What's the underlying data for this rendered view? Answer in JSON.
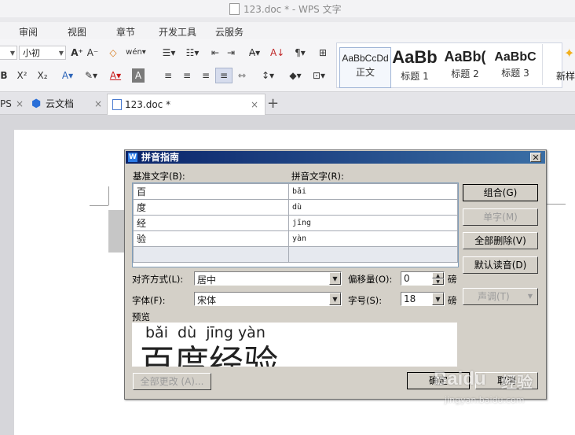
{
  "window": {
    "title": "123.doc * - WPS 文字"
  },
  "menu": {
    "tabs": [
      "审阅",
      "视图",
      "章节",
      "开发工具",
      "云服务"
    ]
  },
  "ribbon": {
    "font_size": "小初",
    "styles": [
      {
        "sample": "AaBbCcDd",
        "label": "正文"
      },
      {
        "sample": "AaBb",
        "label": "标题 1"
      },
      {
        "sample": "AaBb(",
        "label": "标题 2"
      },
      {
        "sample": "AaBbC",
        "label": "标题 3"
      }
    ],
    "new_style_label": "新样"
  },
  "doc_tabs": {
    "wps_partial": "PS",
    "cloud": "云文档",
    "doc": "123.doc *"
  },
  "dialog": {
    "title": "拼音指南",
    "base_text_label": "基准文字(B):",
    "pinyin_text_label": "拼音文字(R):",
    "rows": [
      {
        "base": "百",
        "pinyin": "bǎi"
      },
      {
        "base": "度",
        "pinyin": "dù"
      },
      {
        "base": "经",
        "pinyin": "jīng"
      },
      {
        "base": "验",
        "pinyin": "yàn"
      },
      {
        "base": "",
        "pinyin": ""
      }
    ],
    "buttons": {
      "combine": "组合(G)",
      "single": "单字(M)",
      "delete_all": "全部删除(V)",
      "default_reading": "默认读音(D)",
      "tone": "声调(T)",
      "change_all": "全部更改 (A)...",
      "ok": "确定",
      "cancel": "取消"
    },
    "align_label": "对齐方式(L):",
    "align_value": "居中",
    "offset_label": "偏移量(O):",
    "offset_value": "0",
    "offset_unit": "磅",
    "font_label": "字体(F):",
    "font_value": "宋体",
    "size_label": "字号(S):",
    "size_value": "18",
    "size_unit": "磅",
    "preview_label": "预览",
    "preview_pinyin": "bǎi  dù  jīng yàn",
    "preview_text": "百度经验"
  },
  "watermark": {
    "brand": "Baidu",
    "sub": "经验",
    "url": "jingyan.baidu.com"
  }
}
